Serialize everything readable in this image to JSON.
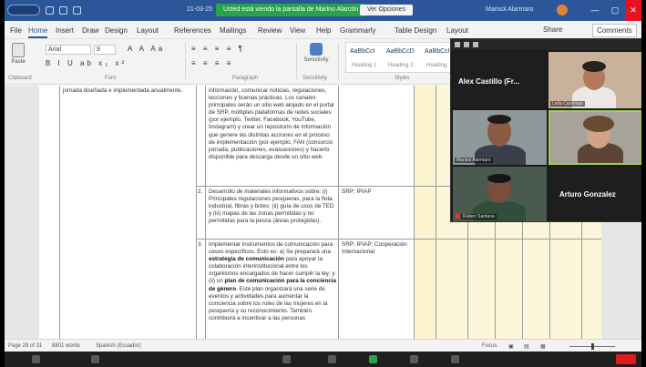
{
  "titlebar": {
    "doc_title": "21-03-25",
    "zoom_banner": "Usted está viendo la pantalla de Marino Alarcón",
    "view_options": "Ver Opciones",
    "user_name": "Marisol Alarmaro"
  },
  "menu": {
    "items": [
      "File",
      "Home",
      "Insert",
      "Draw",
      "Design",
      "Layout",
      "References",
      "Mailings",
      "Review",
      "View",
      "Help",
      "Grammarly",
      "Table Design",
      "Layout"
    ],
    "share": "Share",
    "comments": "Comments"
  },
  "ribbon": {
    "paste": "Paste",
    "font": "Arial",
    "size": "9",
    "format_row_1": "B I U ab x₂ x²",
    "format_row_2": "A A Aa",
    "para_row_1": "≡ ≡ ≡ ≡ ¶",
    "para_row_2": "≡ ≡ ≡ ≡",
    "styles": [
      "AaBbCcI",
      "AaBbCcD",
      "AaBbCcI"
    ],
    "style_names": [
      "Heading 1",
      "Heading 2",
      "Heading"
    ],
    "sensitivity": "Sensitivity",
    "group_labels": [
      "Clipboard",
      "Font",
      "Paragraph",
      "Sensitivity",
      "Styles"
    ]
  },
  "document": {
    "left_text": "jornada diseñada e implementada anualmente.",
    "row1_text": "información, comunicar noticias, regulaciones, lecciones y buenas prácticas. Los canales principales serán un sitio web alojado en el portal de SRP, múltiples plataformas de redes sociales (por ejemplo, Twitter, Facebook, YouTube, Instagram) y crear un repositorio de información que genere las distintas acciones en el proceso de implementación (por ejemplo, FAN (consorcio jornada, publicaciones, evaluaciones) y hacerlo disponible para descarga desde un sitio web.",
    "row2_num": "2.",
    "row2_text": "Desarrollo de materiales informativos sobre: (i) Principales regulaciones pesqueras, para la flota industrial, fibras y botes; (ii) guía de usos de TED y (iii) mapas de las zonas permitidas y no permitidas para la pesca (áreas protegidas).",
    "row2_resp": "SRP; IPIAP",
    "row3_num": "3.",
    "row3_text_a": "Implementar instrumentos de comunicación para casos específicos. Esto es: a) Se preparará una",
    "row3_bold_a": "estrategia de comunicación",
    "row3_text_b": "para apoyar la colaboración interinstitucional entre los organismos encargados de hacer cumplir la ley; y (ii) un",
    "row3_bold_b": "plan de comunicación para la conciencia de género",
    "row3_text_c": ". Este plan organizará una serie de eventos y actividades para aumentar la conciencia sobre los roles de las mujeres en la pesquería y su reconocimiento. También contribuirá a incentivar a las personas",
    "row3_resp": "SRP; IPIAP; Cooperación Internacional"
  },
  "zoom": {
    "tile_top_name": "Alex Castillo (Fr...",
    "tile_top_small": "Leila Cardenas",
    "tile_mid_left": "Marisol Alarmaro",
    "tile_bottom_left": "Ruben Santana",
    "tile_bottom_name": "Arturo Gonzalez"
  },
  "status": {
    "page": "Page 29 of 31",
    "words": "8801 words",
    "language": "Spanish (Ecuador)",
    "focus": "Focus"
  }
}
